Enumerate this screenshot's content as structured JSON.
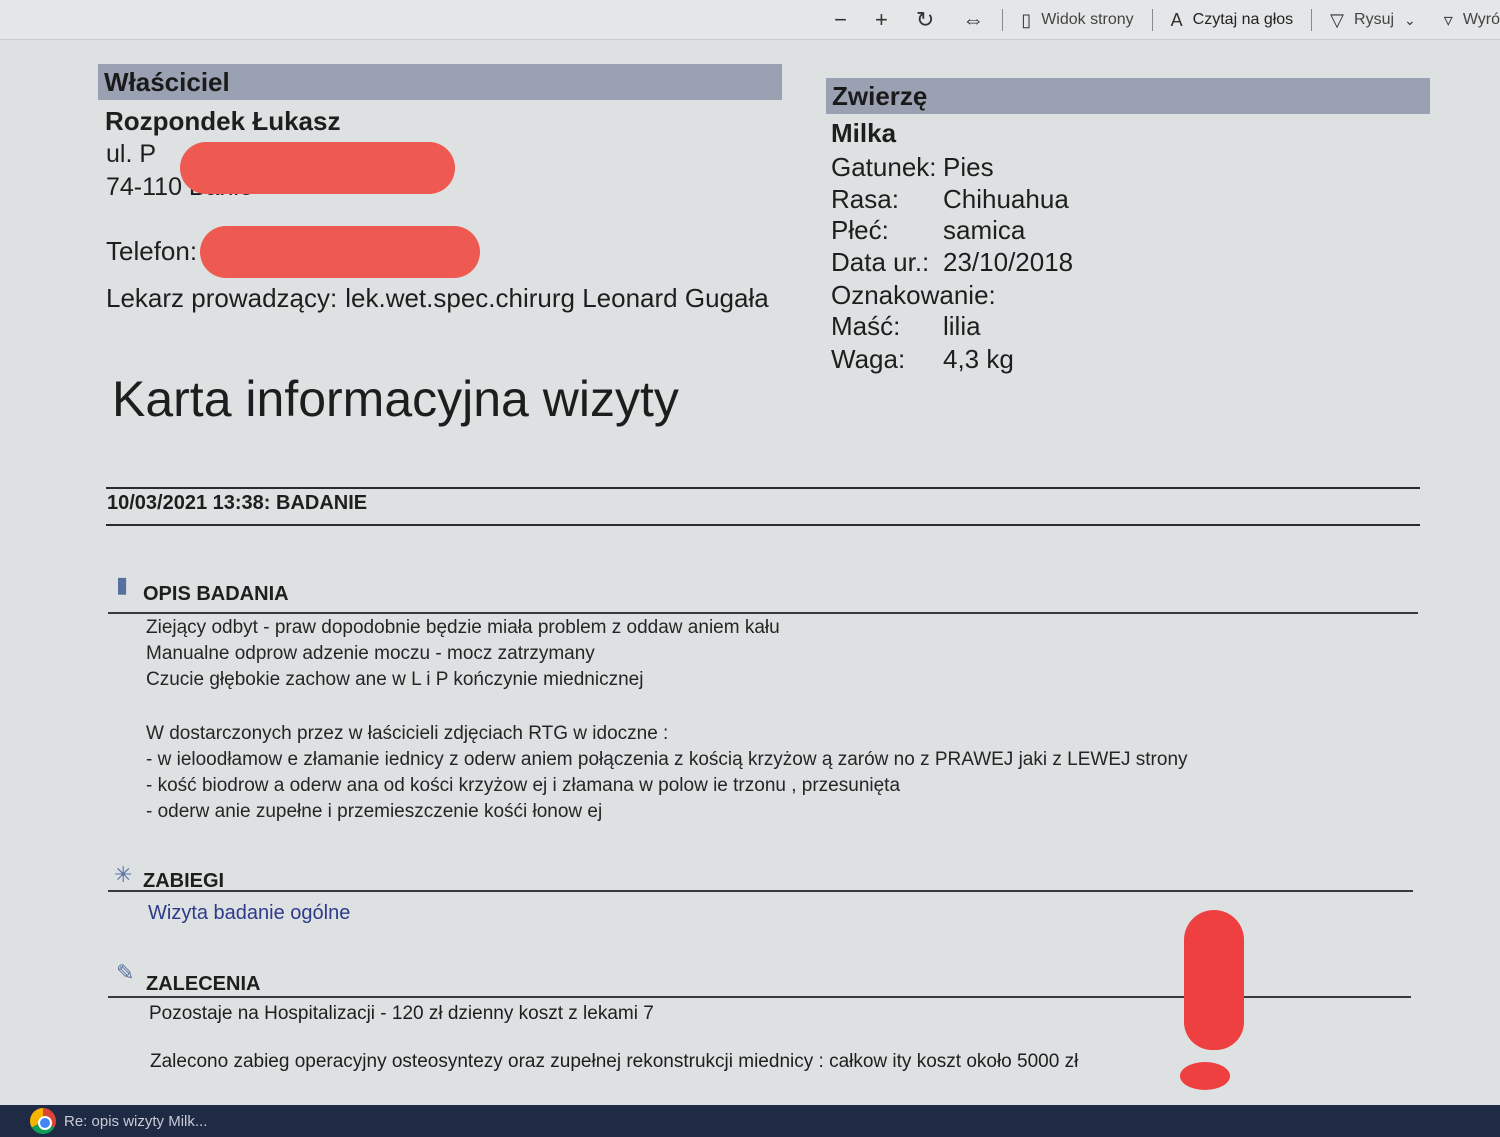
{
  "toolbar": {
    "zoom_out_icon": "minus-icon",
    "zoom_in_icon": "plus-icon",
    "rotate_icon": "rotate-icon",
    "fit_icon": "fit-width-icon",
    "page_view_label": "Widok strony",
    "read_aloud_label": "Czytaj na głos",
    "draw_label": "Rysuj",
    "highlight_label": "Wyró"
  },
  "owner": {
    "header": "Właściciel",
    "name": "Rozpondek Łukasz",
    "street": "ul. P",
    "city": "74-110 Banie",
    "phone_label": "Telefon:",
    "doctor_label": "Lekarz prowadzący:",
    "doctor_value": "lek.wet.spec.chirurg Leonard Gugała"
  },
  "animal": {
    "header": "Zwierzę",
    "name": "Milka",
    "attributes": [
      {
        "key": "Gatunek:",
        "value": "Pies"
      },
      {
        "key": "Rasa:",
        "value": "Chihuahua"
      },
      {
        "key": "Płeć:",
        "value": "samica"
      },
      {
        "key": "Data ur.:",
        "value": "23/10/2018"
      },
      {
        "key": "Oznakowanie:",
        "value": ""
      },
      {
        "key": "Maść:",
        "value": "lilia"
      },
      {
        "key": "Waga:",
        "value": "4,3 kg"
      }
    ]
  },
  "document": {
    "title": "Karta informacyjna wizyty",
    "visit_header": "10/03/2021 13:38: BADANIE",
    "opis": {
      "title": "OPIS BADANIA",
      "lines": [
        "Ziejący odbyt - praw dopodobnie będzie miała problem z oddaw aniem kału",
        "Manualne odprow adzenie moczu - mocz zatrzymany",
        "Czucie głębokie zachow ane w  L i P kończynie miednicznej"
      ],
      "lines2": [
        "W dostarczonych przez w łaścicieli zdjęciach RTG w idoczne :",
        "- w ieloodłamow e złamanie iednicy z oderw aniem połączenia z kością krzyżow ą zarów no z PRAWEJ  jaki z LEWEJ strony",
        "- kość biodrow a oderw ana od kości krzyżow ej i złamana w  polow ie trzonu , przesunięta",
        "- oderw anie zupełne i przemieszczenie kośći łonow ej"
      ]
    },
    "zabiegi": {
      "title": "ZABIEGI",
      "item": "Wizyta badanie ogólne"
    },
    "zalecenia": {
      "title": "ZALECENIA",
      "line1": "Pozostaje na Hospitalizacji - 120 zł dzienny koszt z lekami 7",
      "line2": "Zalecono zabieg operacyjny osteosyntezy oraz zupełnej rekonstrukcji miednicy : całkow ity koszt około 5000 zł"
    }
  },
  "taskbar": {
    "item_label": "Re: opis wizyty Milk..."
  },
  "colors": {
    "header_bar": "#9aa1b2",
    "redaction": "#ee5a52",
    "exclamation": "#ee4040",
    "link_text": "#2d3a8a"
  }
}
